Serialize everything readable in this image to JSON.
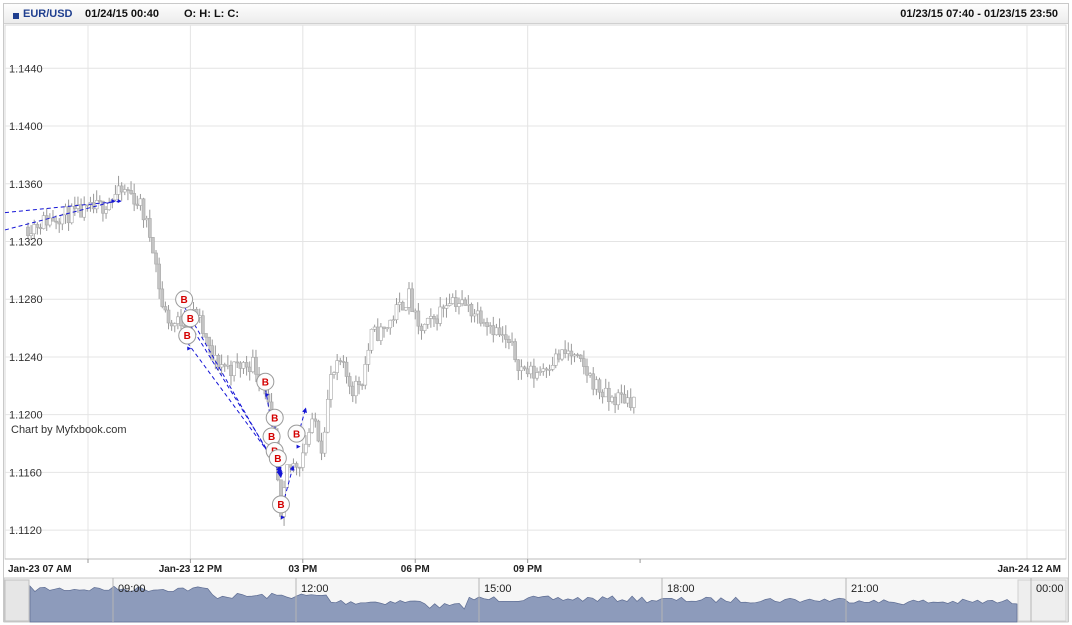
{
  "header": {
    "symbol": "EUR/USD",
    "datetime": "01/24/15 00:40",
    "ohlc": "O: H: L: C:",
    "range": "01/23/15 07:40 - 01/23/15 23:50"
  },
  "watermark": "Chart by Myfxbook.com",
  "colors": {
    "candle": "#c4c4c4",
    "grid": "#e4e4e4",
    "trade_line": "#1515d6",
    "marker_text": "#d40000",
    "navigator_fill": "#8d9bbb"
  },
  "chart_data": {
    "type": "candlestick",
    "ylim": [
      1.11,
      1.147
    ],
    "y_ticks": [
      "1.1440",
      "1.1400",
      "1.1360",
      "1.1320",
      "1.1280",
      "1.1240",
      "1.1200",
      "1.1160",
      "1.1120"
    ],
    "x_ticks": [
      "Jan-23 07 AM",
      "Jan-23 12 PM",
      "03 PM",
      "06 PM",
      "09 PM",
      "Jan-24 12 AM"
    ],
    "time_start": "07:40",
    "time_end": "23:50",
    "interval_minutes": 5,
    "close_path": [
      [
        "07:40",
        1.133
      ],
      [
        "08:30",
        1.1338
      ],
      [
        "09:10",
        1.134
      ],
      [
        "09:40",
        1.1345
      ],
      [
        "10:00",
        1.1352
      ],
      [
        "10:20",
        1.1355
      ],
      [
        "10:40",
        1.1345
      ],
      [
        "11:00",
        1.1318
      ],
      [
        "11:15",
        1.1275
      ],
      [
        "11:30",
        1.1262
      ],
      [
        "12:10",
        1.127
      ],
      [
        "12:35",
        1.1238
      ],
      [
        "13:05",
        1.1232
      ],
      [
        "13:40",
        1.1236
      ],
      [
        "14:00",
        1.1218
      ],
      [
        "14:15",
        1.118
      ],
      [
        "14:25",
        1.1125
      ],
      [
        "14:35",
        1.1162
      ],
      [
        "14:55",
        1.1168
      ],
      [
        "15:10",
        1.1188
      ],
      [
        "15:20",
        1.1195
      ],
      [
        "15:30",
        1.1178
      ],
      [
        "15:45",
        1.1225
      ],
      [
        "16:00",
        1.1235
      ],
      [
        "16:20",
        1.1218
      ],
      [
        "16:35",
        1.1225
      ],
      [
        "16:50",
        1.1255
      ],
      [
        "17:10",
        1.1258
      ],
      [
        "17:30",
        1.1272
      ],
      [
        "17:50",
        1.1282
      ],
      [
        "18:05",
        1.1258
      ],
      [
        "18:30",
        1.1265
      ],
      [
        "18:55",
        1.1282
      ],
      [
        "19:20",
        1.1275
      ],
      [
        "19:50",
        1.1268
      ],
      [
        "20:10",
        1.1258
      ],
      [
        "20:35",
        1.1245
      ],
      [
        "20:50",
        1.1232
      ],
      [
        "21:10",
        1.1228
      ],
      [
        "21:40",
        1.1238
      ],
      [
        "22:05",
        1.1243
      ],
      [
        "22:30",
        1.1232
      ],
      [
        "22:50",
        1.122
      ],
      [
        "23:10",
        1.121
      ],
      [
        "23:30",
        1.1212
      ],
      [
        "23:50",
        1.121
      ]
    ],
    "trades": [
      {
        "label": "B",
        "time": "11:50",
        "open": 1.1275,
        "close": 1.1158
      },
      {
        "label": "B",
        "time": "12:00",
        "open": 1.1262,
        "close": 1.116
      },
      {
        "label": "B",
        "time": "11:55",
        "open": 1.125,
        "close": 1.1162
      },
      {
        "label": "B",
        "time": "14:00",
        "open": 1.1218,
        "close": 1.1157
      },
      {
        "label": "B",
        "time": "14:15",
        "open": 1.1193,
        "close": 1.1156
      },
      {
        "label": "B",
        "time": "14:10",
        "open": 1.118,
        "close": 1.1158
      },
      {
        "label": "B",
        "time": "14:15",
        "open": 1.117,
        "close": 1.116
      },
      {
        "label": "B",
        "time": "14:20",
        "open": 1.1165,
        "close": 1.116
      },
      {
        "label": "B",
        "time": "14:25",
        "open": 1.1133,
        "close": 1.1165
      },
      {
        "label": "B",
        "time": "14:50",
        "open": 1.1182,
        "close": 1.1205
      }
    ],
    "trade_lines": [
      {
        "start": "07:40",
        "start_price": 1.134,
        "end": "10:10",
        "end_price": 1.1348
      },
      {
        "start": "07:40",
        "start_price": 1.1328,
        "end": "10:00",
        "end_price": 1.1348
      }
    ],
    "navigator": {
      "labels": [
        "09:00",
        "12:00",
        "15:00",
        "18:00",
        "21:00",
        "00:00"
      ]
    }
  }
}
